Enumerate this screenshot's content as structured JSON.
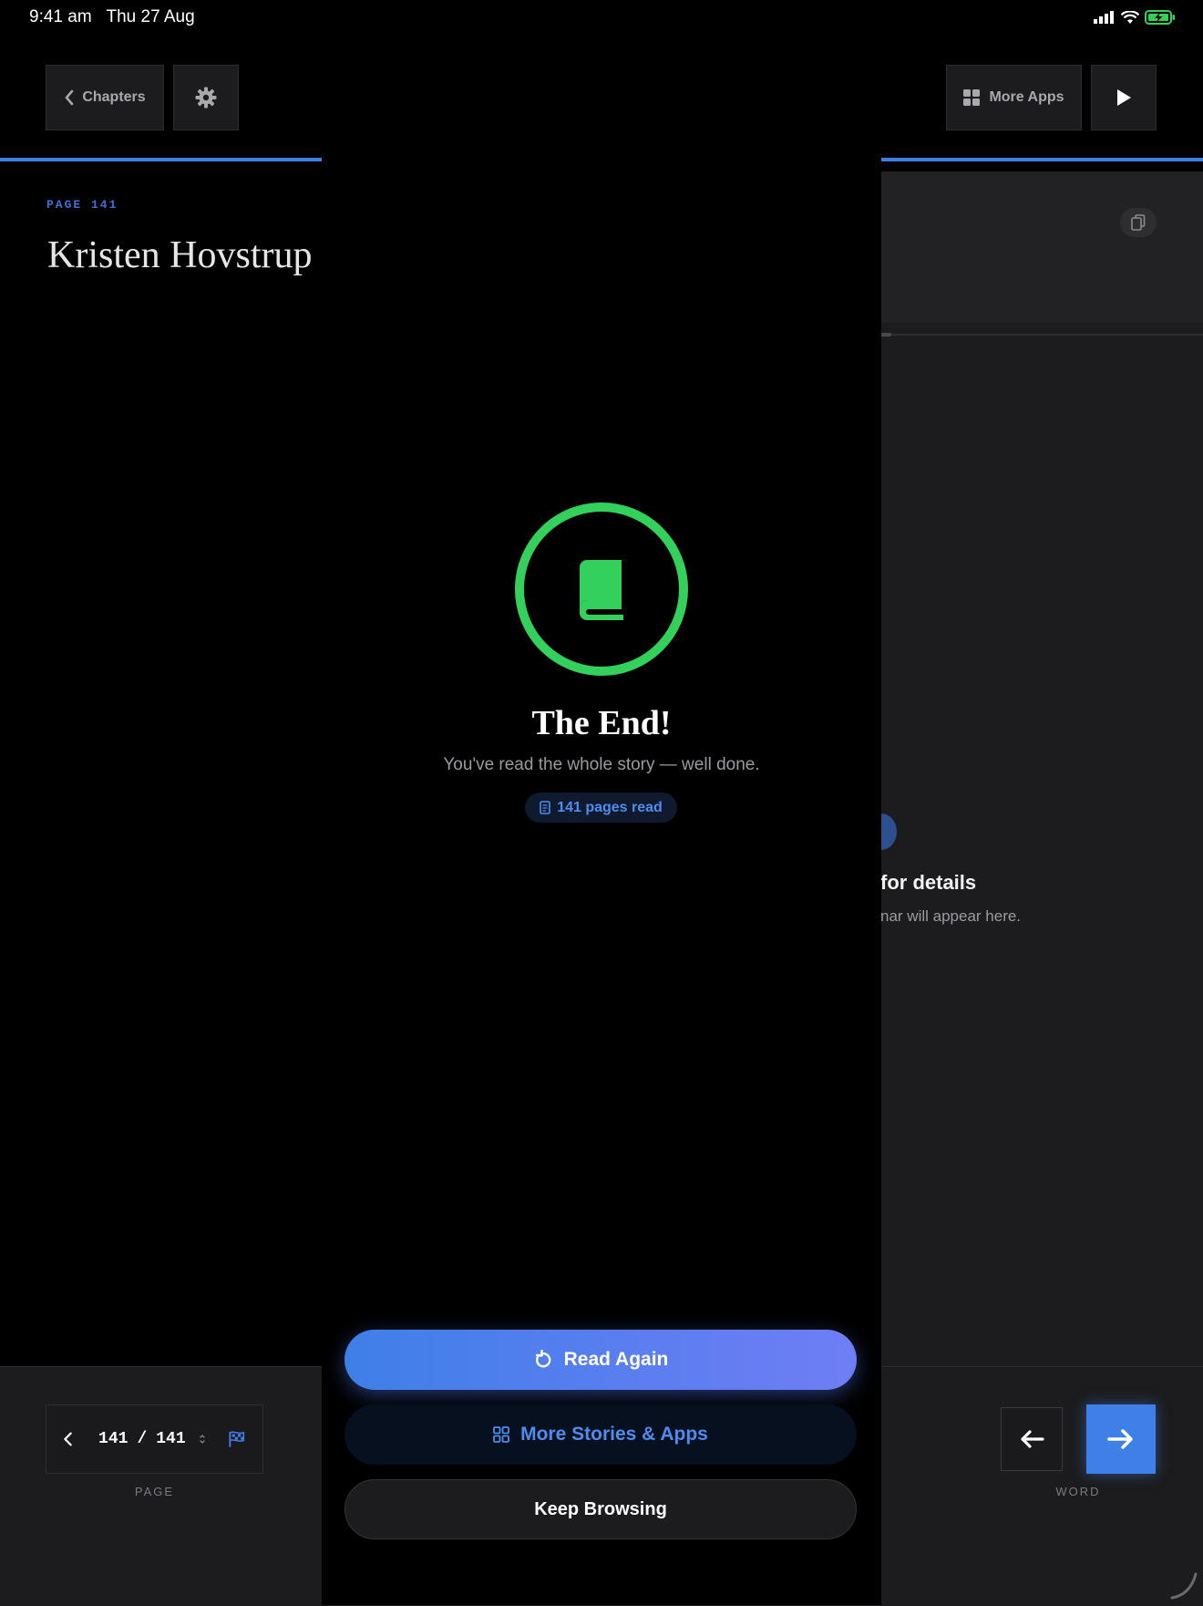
{
  "status_bar": {
    "time": "9:41 am",
    "date": "Thu 27 Aug",
    "battery_color": "#33d15b"
  },
  "top_bar": {
    "chapters_label": "Chapters",
    "more_apps_label": "More Apps"
  },
  "reader": {
    "page_label": "PAGE 141",
    "title": "Kristen Hovstrup"
  },
  "side_panel": {
    "details_title": "for details",
    "details_subtitle": "nar will appear here."
  },
  "completion": {
    "title": "The End!",
    "subtitle": "You've read the whole story — well done.",
    "pages_badge": "141 pages read",
    "accent": "#33d15b"
  },
  "actions": {
    "read_again": "Read Again",
    "more_stories": "More Stories & Apps",
    "keep_browsing": "Keep Browsing"
  },
  "bottom_bar": {
    "current_page": "141",
    "separator": "/",
    "total_pages": "141",
    "page_caption": "PAGE",
    "word_caption": "WORD"
  },
  "colors": {
    "accent_blue": "#3f7fe8",
    "gradient_end": "#6f7ef5"
  }
}
